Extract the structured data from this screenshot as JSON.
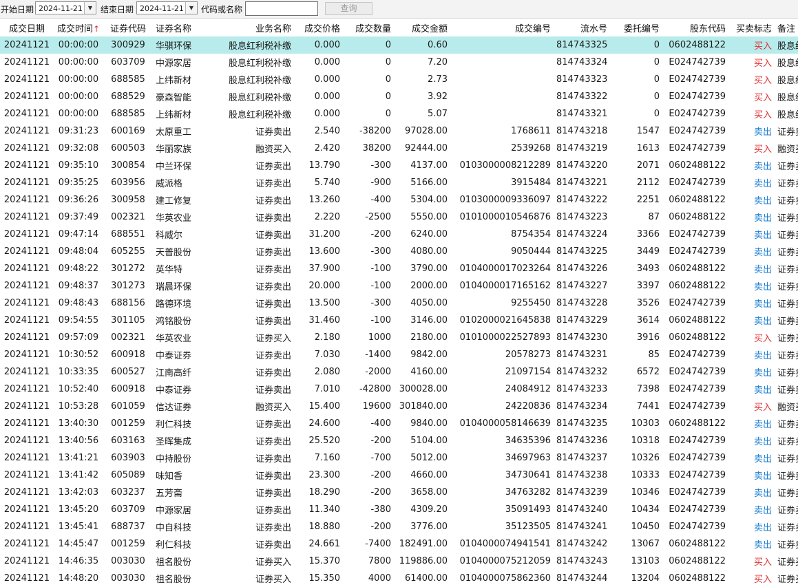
{
  "toolbar": {
    "start_label": "开始日期",
    "start_date": "2024-11-21",
    "end_label": "结束日期",
    "end_date": "2024-11-21",
    "code_label": "代码或名称",
    "code_value": "",
    "query_label": "查询",
    "dropdown_icon": "chevron-down-icon"
  },
  "columns": [
    "成交日期",
    "成交时间",
    "证券代码",
    "证券名称",
    "业务名称",
    "成交价格",
    "成交数量",
    "成交金额",
    "成交编号",
    "流水号",
    "委托编号",
    "股东代码",
    "买卖标志",
    "备注"
  ],
  "sort_indicator": "↑",
  "colors": {
    "buy": "#e03030",
    "sell": "#1a7fd4",
    "selected_row": "#b8ecec"
  },
  "rows": [
    [
      "20241121",
      "00:00:00",
      "300929",
      "华骐环保",
      "股息红利税补缴",
      "0.000",
      "0",
      "0.60",
      "",
      "814743325",
      "0",
      "0602488122",
      "买入",
      "股息红利"
    ],
    [
      "20241121",
      "00:00:00",
      "603709",
      "中源家居",
      "股息红利税补缴",
      "0.000",
      "0",
      "7.20",
      "",
      "814743324",
      "0",
      "E024742739",
      "买入",
      "股息红利"
    ],
    [
      "20241121",
      "00:00:00",
      "688585",
      "上纬新材",
      "股息红利税补缴",
      "0.000",
      "0",
      "2.73",
      "",
      "814743323",
      "0",
      "E024742739",
      "买入",
      "股息红利"
    ],
    [
      "20241121",
      "00:00:00",
      "688529",
      "豪森智能",
      "股息红利税补缴",
      "0.000",
      "0",
      "3.92",
      "",
      "814743322",
      "0",
      "E024742739",
      "买入",
      "股息红利"
    ],
    [
      "20241121",
      "00:00:00",
      "688585",
      "上纬新材",
      "股息红利税补缴",
      "0.000",
      "0",
      "5.07",
      "",
      "814743321",
      "0",
      "E024742739",
      "买入",
      "股息红利"
    ],
    [
      "20241121",
      "09:31:23",
      "600169",
      "太原重工",
      "证券卖出",
      "2.540",
      "-38200",
      "97028.00",
      "1768611",
      "814743218",
      "1547",
      "E024742739",
      "卖出",
      "证券卖出"
    ],
    [
      "20241121",
      "09:32:08",
      "600503",
      "华丽家族",
      "融资买入",
      "2.420",
      "38200",
      "92444.00",
      "2539268",
      "814743219",
      "1613",
      "E024742739",
      "买入",
      "融资买入"
    ],
    [
      "20241121",
      "09:35:10",
      "300854",
      "中兰环保",
      "证券卖出",
      "13.790",
      "-300",
      "4137.00",
      "0103000008212289",
      "814743220",
      "2071",
      "0602488122",
      "卖出",
      "证券卖出"
    ],
    [
      "20241121",
      "09:35:25",
      "603956",
      "威派格",
      "证券卖出",
      "5.740",
      "-900",
      "5166.00",
      "3915484",
      "814743221",
      "2112",
      "E024742739",
      "卖出",
      "证券卖出"
    ],
    [
      "20241121",
      "09:36:26",
      "300958",
      "建工修复",
      "证券卖出",
      "13.260",
      "-400",
      "5304.00",
      "0103000009336097",
      "814743222",
      "2251",
      "0602488122",
      "卖出",
      "证券卖出"
    ],
    [
      "20241121",
      "09:37:49",
      "002321",
      "华英农业",
      "证券卖出",
      "2.220",
      "-2500",
      "5550.00",
      "0101000010546876",
      "814743223",
      "87",
      "0602488122",
      "卖出",
      "证券卖出"
    ],
    [
      "20241121",
      "09:47:14",
      "688551",
      "科威尔",
      "证券卖出",
      "31.200",
      "-200",
      "6240.00",
      "8754354",
      "814743224",
      "3366",
      "E024742739",
      "卖出",
      "证券卖出"
    ],
    [
      "20241121",
      "09:48:04",
      "605255",
      "天普股份",
      "证券卖出",
      "13.600",
      "-300",
      "4080.00",
      "9050444",
      "814743225",
      "3449",
      "E024742739",
      "卖出",
      "证券卖出"
    ],
    [
      "20241121",
      "09:48:22",
      "301272",
      "英华特",
      "证券卖出",
      "37.900",
      "-100",
      "3790.00",
      "0104000017023264",
      "814743226",
      "3493",
      "0602488122",
      "卖出",
      "证券卖出"
    ],
    [
      "20241121",
      "09:48:37",
      "301273",
      "瑞晨环保",
      "证券卖出",
      "20.000",
      "-100",
      "2000.00",
      "0104000017165162",
      "814743227",
      "3397",
      "0602488122",
      "卖出",
      "证券卖出"
    ],
    [
      "20241121",
      "09:48:43",
      "688156",
      "路德环境",
      "证券卖出",
      "13.500",
      "-300",
      "4050.00",
      "9255450",
      "814743228",
      "3526",
      "E024742739",
      "卖出",
      "证券卖出"
    ],
    [
      "20241121",
      "09:54:55",
      "301105",
      "鸿铭股份",
      "证券卖出",
      "31.460",
      "-100",
      "3146.00",
      "0102000021645838",
      "814743229",
      "3614",
      "0602488122",
      "卖出",
      "证券卖出"
    ],
    [
      "20241121",
      "09:57:09",
      "002321",
      "华英农业",
      "证券买入",
      "2.180",
      "1000",
      "2180.00",
      "0101000022527893",
      "814743230",
      "3916",
      "0602488122",
      "买入",
      "证券买入"
    ],
    [
      "20241121",
      "10:30:52",
      "600918",
      "中泰证券",
      "证券卖出",
      "7.030",
      "-1400",
      "9842.00",
      "20578273",
      "814743231",
      "85",
      "E024742739",
      "卖出",
      "证券卖出"
    ],
    [
      "20241121",
      "10:33:35",
      "600527",
      "江南高纤",
      "证券卖出",
      "2.080",
      "-2000",
      "4160.00",
      "21097154",
      "814743232",
      "6572",
      "E024742739",
      "卖出",
      "证券卖出"
    ],
    [
      "20241121",
      "10:52:40",
      "600918",
      "中泰证券",
      "证券卖出",
      "7.010",
      "-42800",
      "300028.00",
      "24084912",
      "814743233",
      "7398",
      "E024742739",
      "卖出",
      "证券卖出"
    ],
    [
      "20241121",
      "10:53:28",
      "601059",
      "信达证券",
      "融资买入",
      "15.400",
      "19600",
      "301840.00",
      "24220836",
      "814743234",
      "7441",
      "E024742739",
      "买入",
      "融资买入"
    ],
    [
      "20241121",
      "13:40:30",
      "001259",
      "利仁科技",
      "证券卖出",
      "24.600",
      "-400",
      "9840.00",
      "0104000058146639",
      "814743235",
      "10303",
      "0602488122",
      "卖出",
      "证券卖出"
    ],
    [
      "20241121",
      "13:40:56",
      "603163",
      "圣晖集成",
      "证券卖出",
      "25.520",
      "-200",
      "5104.00",
      "34635396",
      "814743236",
      "10318",
      "E024742739",
      "卖出",
      "证券卖出"
    ],
    [
      "20241121",
      "13:41:21",
      "603903",
      "中持股份",
      "证券卖出",
      "7.160",
      "-700",
      "5012.00",
      "34697963",
      "814743237",
      "10326",
      "E024742739",
      "卖出",
      "证券卖出"
    ],
    [
      "20241121",
      "13:41:42",
      "605089",
      "味知香",
      "证券卖出",
      "23.300",
      "-200",
      "4660.00",
      "34730641",
      "814743238",
      "10333",
      "E024742739",
      "卖出",
      "证券卖出"
    ],
    [
      "20241121",
      "13:42:03",
      "603237",
      "五芳斋",
      "证券卖出",
      "18.290",
      "-200",
      "3658.00",
      "34763282",
      "814743239",
      "10346",
      "E024742739",
      "卖出",
      "证券卖出"
    ],
    [
      "20241121",
      "13:45:20",
      "603709",
      "中源家居",
      "证券卖出",
      "11.340",
      "-380",
      "4309.20",
      "35091493",
      "814743240",
      "10434",
      "E024742739",
      "卖出",
      "证券卖出"
    ],
    [
      "20241121",
      "13:45:41",
      "688737",
      "中自科技",
      "证券卖出",
      "18.880",
      "-200",
      "3776.00",
      "35123505",
      "814743241",
      "10450",
      "E024742739",
      "卖出",
      "证券卖出"
    ],
    [
      "20241121",
      "14:45:47",
      "001259",
      "利仁科技",
      "证券卖出",
      "24.661",
      "-7400",
      "182491.00",
      "0104000074941541",
      "814743242",
      "13067",
      "0602488122",
      "卖出",
      "证券卖出"
    ],
    [
      "20241121",
      "14:46:35",
      "003030",
      "祖名股份",
      "证券买入",
      "15.370",
      "7800",
      "119886.00",
      "0104000075212059",
      "814743243",
      "13103",
      "0602488122",
      "买入",
      "证券买入"
    ],
    [
      "20241121",
      "14:48:20",
      "003030",
      "祖名股份",
      "证券买入",
      "15.350",
      "4000",
      "61400.00",
      "0104000075862360",
      "814743244",
      "13204",
      "0602488122",
      "买入",
      "证券买入"
    ]
  ]
}
